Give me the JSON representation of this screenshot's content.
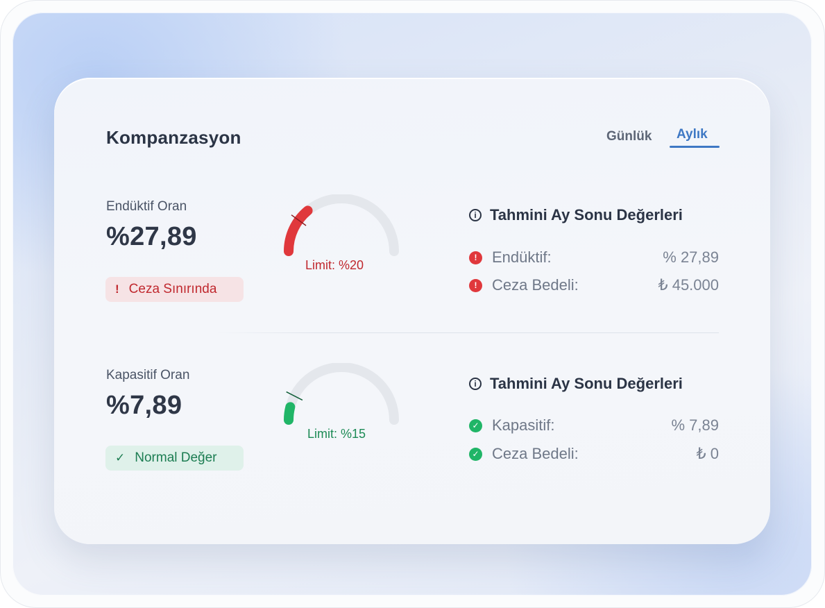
{
  "header": {
    "title": "Kompanzasyon"
  },
  "tabs": [
    {
      "label": "Günlük",
      "active": false
    },
    {
      "label": "Aylık",
      "active": true
    }
  ],
  "inductive": {
    "label": "Endüktif Oran",
    "value": "%27,89",
    "status": "Ceza Sınırında",
    "status_icon": "exclamation-icon",
    "limit_text": "Limit: %20",
    "gauge_fraction": 0.28,
    "limit_fraction": 0.2,
    "color": "#e0383c",
    "estimates": {
      "title": "Tahmini Ay Sonu Değerleri",
      "rows": [
        {
          "label": "Endüktif:",
          "value": "% 27,89",
          "icon": "alert-circle-icon"
        },
        {
          "label": "Ceza Bedeli:",
          "value": "₺ 45.000",
          "icon": "alert-circle-icon"
        }
      ]
    }
  },
  "capacitive": {
    "label": "Kapasitif Oran",
    "value": "%7,89",
    "status": "Normal Değer",
    "status_icon": "check-icon",
    "limit_text": "Limit: %15",
    "gauge_fraction": 0.079,
    "limit_fraction": 0.15,
    "color": "#20b567",
    "estimates": {
      "title": "Tahmini Ay Sonu Değerleri",
      "rows": [
        {
          "label": "Kapasitif:",
          "value": "% 7,89",
          "icon": "check-circle-icon"
        },
        {
          "label": "Ceza Bedeli:",
          "value": "₺ 0",
          "icon": "check-circle-icon"
        }
      ]
    }
  }
}
